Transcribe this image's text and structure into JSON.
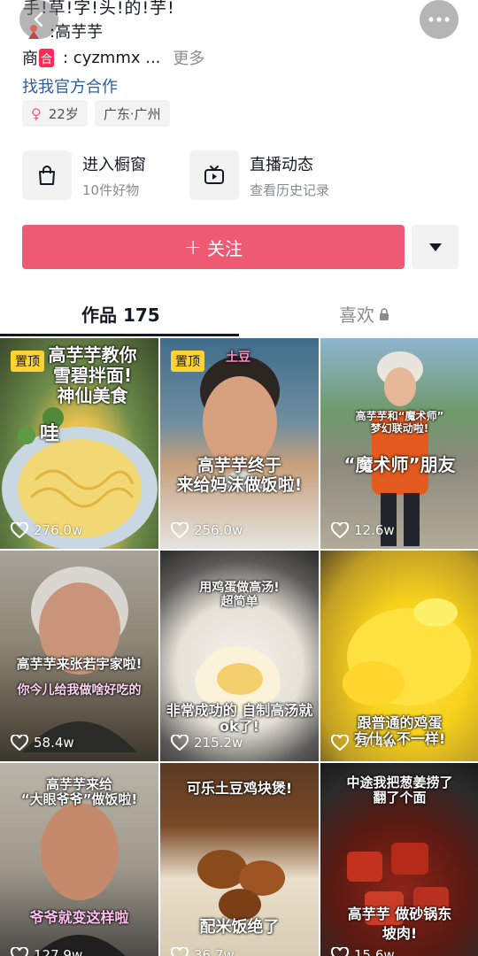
{
  "profile": {
    "bio_partial": "手!草!字!头!的!芋!",
    "bio_name_line": ":高芋芋",
    "shop_prefix": "商",
    "shop_badge": "合",
    "shop_value": ": cyzmmx ...",
    "shop_more": "更多",
    "official_link": "找我官方合作",
    "tags": [
      {
        "icon": "female-symbol",
        "text": "22岁"
      },
      {
        "text": "广东·广州"
      }
    ]
  },
  "entries": {
    "window": {
      "title": "进入橱窗",
      "subtitle": "10件好物",
      "icon": "shopping-bag-icon"
    },
    "live": {
      "title": "直播动态",
      "subtitle": "查看历史记录",
      "icon": "tv-play-icon"
    }
  },
  "actions": {
    "follow_label": "关注"
  },
  "tabs": {
    "works_label": "作品 175",
    "likes_label": "喜欢"
  },
  "videos": [
    {
      "pinned": "置顶",
      "likes": "276.0w",
      "caption": [
        "高芋芋教你",
        "雪碧拌面!",
        "神仙美食"
      ],
      "extra": "哇"
    },
    {
      "pinned": "置顶",
      "likes": "256.0w",
      "caption": [
        "高芋芋终于",
        "来给妈沫做饭啦!"
      ],
      "extra": "土豆"
    },
    {
      "likes": "12.6w",
      "caption": [
        "高芋芋和“魔术师”",
        "梦幻联动啦!"
      ],
      "extra": "“魔术师”朋友"
    },
    {
      "likes": "58.4w",
      "caption": [
        "高芋芋来张若宇家啦!"
      ],
      "extra": "你今儿给我做啥好吃的"
    },
    {
      "likes": "215.2w",
      "caption": [
        "用鸡蛋做高汤!",
        "超简单"
      ],
      "extra": "非常成功的 自制高汤就ok了!"
    },
    {
      "likes": "27.4w",
      "caption": [
        "跟普通的鸡蛋",
        "有什么不一样!"
      ],
      "extra": ""
    },
    {
      "likes": "127.9w",
      "caption": [
        "高芋芋来给",
        "“大眼爷爷”做饭啦!"
      ],
      "extra": "爷爷就变这样啦"
    },
    {
      "likes": "36.7w",
      "caption": [
        "可乐土豆鸡块煲!"
      ],
      "extra": "配米饭绝了"
    },
    {
      "likes": "15.6w",
      "caption": [
        "中途我把葱姜捞了",
        "翻了个面"
      ],
      "extra": "高芋芋 做砂锅东坡肉!"
    }
  ],
  "colors": {
    "follow_bg": "#ee5a73",
    "pin_bg": "#fdd233",
    "link": "#2f5c9c"
  }
}
